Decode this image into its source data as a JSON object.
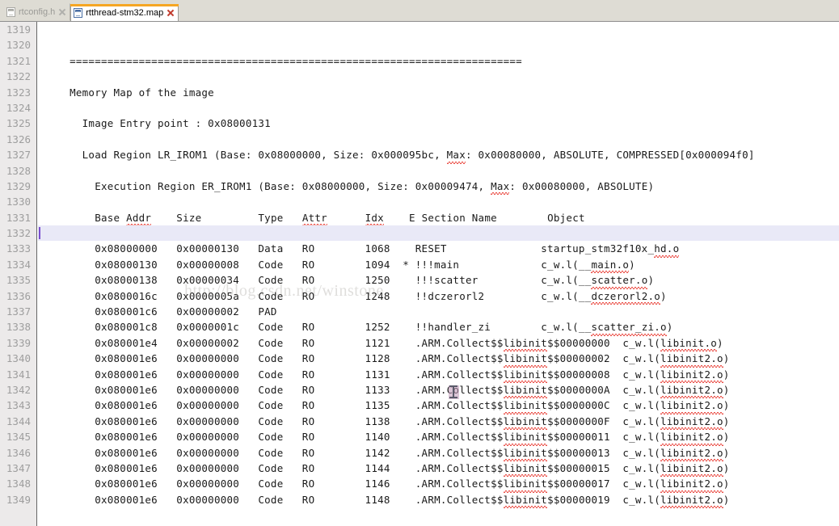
{
  "tabs": [
    {
      "label": "rtconfig.h",
      "active": false,
      "icon": "file-icon",
      "close_icon": "close-icon"
    },
    {
      "label": "rtthread-stm32.map",
      "active": true,
      "icon": "file-icon",
      "close_icon": "close-icon"
    }
  ],
  "editor": {
    "first_line_number": 1319,
    "current_line_number": 1332,
    "watermark": "http://blog.csdn.net/winstone",
    "line_numbers": [
      "1319",
      "1320",
      "1321",
      "1322",
      "1323",
      "1324",
      "1325",
      "1326",
      "1327",
      "1328",
      "1329",
      "1330",
      "1331",
      "1332",
      "1333",
      "1334",
      "1335",
      "1336",
      "1337",
      "1338",
      "1339",
      "1340",
      "1341",
      "1342",
      "1343",
      "1344",
      "1345",
      "1346",
      "1347",
      "1348",
      "1349"
    ],
    "lines": [
      "",
      "",
      "    ========================================================================",
      "",
      "    Memory Map of the image",
      "",
      "      Image Entry point : 0x08000131",
      "",
      "      Load Region LR_IROM1 (Base: 0x08000000, Size: 0x000095bc, Max: 0x00080000, ABSOLUTE, COMPRESSED[0x000094f0]",
      "",
      "        Execution Region ER_IROM1 (Base: 0x08000000, Size: 0x00009474, Max: 0x00080000, ABSOLUTE)",
      "",
      "        Base Addr    Size         Type   Attr      Idx    E Section Name        Object",
      "",
      "        0x08000000   0x00000130   Data   RO        1068    RESET               startup_stm32f10x_hd.o",
      "        0x08000130   0x00000008   Code   RO        1094  * !!!main             c_w.l(__main.o)",
      "        0x08000138   0x00000034   Code   RO        1250    !!!scatter          c_w.l(__scatter.o)",
      "        0x0800016c   0x0000005a   Code   RO        1248    !!dczerorl2         c_w.l(__dczerorl2.o)",
      "        0x080001c6   0x00000002   PAD",
      "        0x080001c8   0x0000001c   Code   RO        1252    !!handler_zi        c_w.l(__scatter_zi.o)",
      "        0x080001e4   0x00000002   Code   RO        1121    .ARM.Collect$$libinit$$00000000  c_w.l(libinit.o)",
      "        0x080001e6   0x00000000   Code   RO        1128    .ARM.Collect$$libinit$$00000002  c_w.l(libinit2.o)",
      "        0x080001e6   0x00000000   Code   RO        1131    .ARM.Collect$$libinit$$00000008  c_w.l(libinit2.o)",
      "        0x080001e6   0x00000000   Code   RO        1133    .ARM.Collect$$libinit$$0000000A  c_w.l(libinit2.o)",
      "        0x080001e6   0x00000000   Code   RO        1135    .ARM.Collect$$libinit$$0000000C  c_w.l(libinit2.o)",
      "        0x080001e6   0x00000000   Code   RO        1138    .ARM.Collect$$libinit$$0000000F  c_w.l(libinit2.o)",
      "        0x080001e6   0x00000000   Code   RO        1140    .ARM.Collect$$libinit$$00000011  c_w.l(libinit2.o)",
      "        0x080001e6   0x00000000   Code   RO        1142    .ARM.Collect$$libinit$$00000013  c_w.l(libinit2.o)",
      "        0x080001e6   0x00000000   Code   RO        1144    .ARM.Collect$$libinit$$00000015  c_w.l(libinit2.o)",
      "        0x080001e6   0x00000000   Code   RO        1146    .ARM.Collect$$libinit$$00000017  c_w.l(libinit2.o)",
      "        0x080001e6   0x00000000   Code   RO        1148    .ARM.Collect$$libinit$$00000019  c_w.l(libinit2.o)"
    ]
  },
  "memory_map": {
    "entry_point": "0x08000131",
    "load_region": {
      "name": "LR_IROM1",
      "base": "0x08000000",
      "size": "0x000095bc",
      "max": "0x00080000",
      "absolute": "ABSOLUTE",
      "compressed": "COMPRESSED[0x000094f0]"
    },
    "execution_region": {
      "name": "ER_IROM1",
      "base": "0x08000000",
      "size": "0x00009474",
      "max": "0x00080000",
      "absolute": "ABSOLUTE"
    },
    "columns": [
      "Base Addr",
      "Size",
      "Type",
      "Attr",
      "Idx",
      "E",
      "Section Name",
      "Object"
    ],
    "rows": [
      {
        "base": "0x08000000",
        "size": "0x00000130",
        "type": "Data",
        "attr": "RO",
        "idx": "1068",
        "e": "",
        "section": "RESET",
        "object": "startup_stm32f10x_hd.o"
      },
      {
        "base": "0x08000130",
        "size": "0x00000008",
        "type": "Code",
        "attr": "RO",
        "idx": "1094",
        "e": "*",
        "section": "!!!main",
        "object": "c_w.l(__main.o)"
      },
      {
        "base": "0x08000138",
        "size": "0x00000034",
        "type": "Code",
        "attr": "RO",
        "idx": "1250",
        "e": "",
        "section": "!!!scatter",
        "object": "c_w.l(__scatter.o)"
      },
      {
        "base": "0x0800016c",
        "size": "0x0000005a",
        "type": "Code",
        "attr": "RO",
        "idx": "1248",
        "e": "",
        "section": "!!dczerorl2",
        "object": "c_w.l(__dczerorl2.o)"
      },
      {
        "base": "0x080001c6",
        "size": "0x00000002",
        "type": "PAD",
        "attr": "",
        "idx": "",
        "e": "",
        "section": "",
        "object": ""
      },
      {
        "base": "0x080001c8",
        "size": "0x0000001c",
        "type": "Code",
        "attr": "RO",
        "idx": "1252",
        "e": "",
        "section": "!!handler_zi",
        "object": "c_w.l(__scatter_zi.o)"
      },
      {
        "base": "0x080001e4",
        "size": "0x00000002",
        "type": "Code",
        "attr": "RO",
        "idx": "1121",
        "e": "",
        "section": ".ARM.Collect$$libinit$$00000000",
        "object": "c_w.l(libinit.o)"
      },
      {
        "base": "0x080001e6",
        "size": "0x00000000",
        "type": "Code",
        "attr": "RO",
        "idx": "1128",
        "e": "",
        "section": ".ARM.Collect$$libinit$$00000002",
        "object": "c_w.l(libinit2.o)"
      },
      {
        "base": "0x080001e6",
        "size": "0x00000000",
        "type": "Code",
        "attr": "RO",
        "idx": "1131",
        "e": "",
        "section": ".ARM.Collect$$libinit$$00000008",
        "object": "c_w.l(libinit2.o)"
      },
      {
        "base": "0x080001e6",
        "size": "0x00000000",
        "type": "Code",
        "attr": "RO",
        "idx": "1133",
        "e": "",
        "section": ".ARM.Collect$$libinit$$0000000A",
        "object": "c_w.l(libinit2.o)"
      },
      {
        "base": "0x080001e6",
        "size": "0x00000000",
        "type": "Code",
        "attr": "RO",
        "idx": "1135",
        "e": "",
        "section": ".ARM.Collect$$libinit$$0000000C",
        "object": "c_w.l(libinit2.o)"
      },
      {
        "base": "0x080001e6",
        "size": "0x00000000",
        "type": "Code",
        "attr": "RO",
        "idx": "1138",
        "e": "",
        "section": ".ARM.Collect$$libinit$$0000000F",
        "object": "c_w.l(libinit2.o)"
      },
      {
        "base": "0x080001e6",
        "size": "0x00000000",
        "type": "Code",
        "attr": "RO",
        "idx": "1140",
        "e": "",
        "section": ".ARM.Collect$$libinit$$00000011",
        "object": "c_w.l(libinit2.o)"
      },
      {
        "base": "0x080001e6",
        "size": "0x00000000",
        "type": "Code",
        "attr": "RO",
        "idx": "1142",
        "e": "",
        "section": ".ARM.Collect$$libinit$$00000013",
        "object": "c_w.l(libinit2.o)"
      },
      {
        "base": "0x080001e6",
        "size": "0x00000000",
        "type": "Code",
        "attr": "RO",
        "idx": "1144",
        "e": "",
        "section": ".ARM.Collect$$libinit$$00000015",
        "object": "c_w.l(libinit2.o)"
      },
      {
        "base": "0x080001e6",
        "size": "0x00000000",
        "type": "Code",
        "attr": "RO",
        "idx": "1146",
        "e": "",
        "section": ".ARM.Collect$$libinit$$00000017",
        "object": "c_w.l(libinit2.o)"
      },
      {
        "base": "0x080001e6",
        "size": "0x00000000",
        "type": "Code",
        "attr": "RO",
        "idx": "1148",
        "e": "",
        "section": ".ARM.Collect$$libinit$$00000019",
        "object": "c_w.l(libinit2.o)"
      }
    ]
  },
  "colors": {
    "active_tab_accent": "#f5a623",
    "tabbar_bg": "#dedcd4",
    "gutter_bg": "#eceaea",
    "current_line_bg": "#e9e9f7",
    "caret": "#7a4fcf",
    "spellcheck_underline": "#e8332a",
    "close_icon": "#c0392b"
  }
}
